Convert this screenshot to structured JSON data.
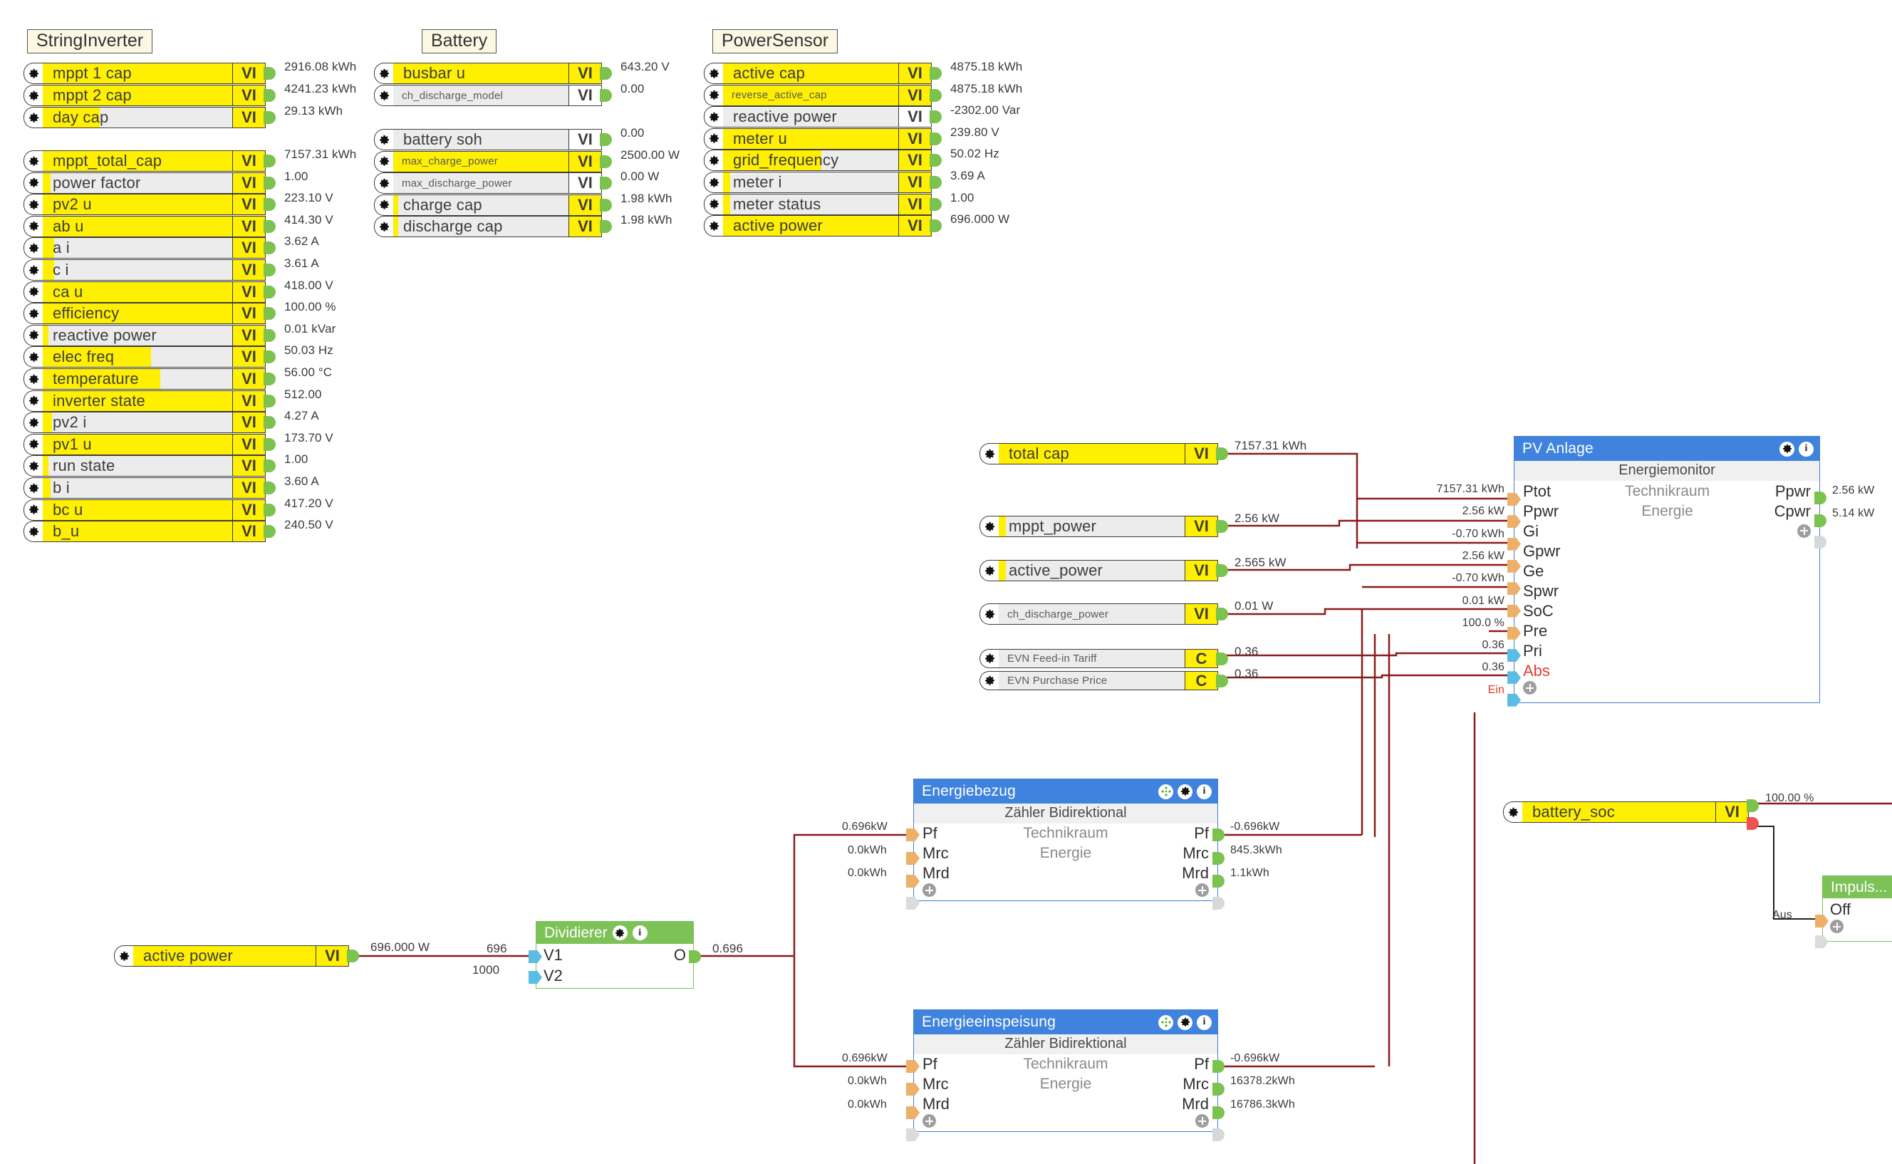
{
  "groups": {
    "string_inverter": {
      "title": "StringInverter"
    },
    "battery": {
      "title": "Battery"
    },
    "power_sensor": {
      "title": "PowerSensor"
    }
  },
  "string_inverter_rows_a": [
    {
      "label": "mppt 1 cap",
      "vi": "VI",
      "value": "2916.08 kWh",
      "fill": 100,
      "vi_yellow": true,
      "small": false
    },
    {
      "label": "mppt 2 cap",
      "vi": "VI",
      "value": "4241.23 kWh",
      "fill": 100,
      "vi_yellow": true,
      "small": false
    },
    {
      "label": "day cap",
      "vi": "VI",
      "value": "29.13 kWh",
      "fill": 30,
      "vi_yellow": true,
      "small": false
    }
  ],
  "string_inverter_rows_b": [
    {
      "label": "mppt_total_cap",
      "vi": "VI",
      "value": "7157.31 kWh",
      "fill": 100,
      "vi_yellow": true,
      "small": false
    },
    {
      "label": "power factor",
      "vi": "VI",
      "value": "1.00",
      "fill": 4,
      "vi_yellow": true,
      "small": false
    },
    {
      "label": "pv2 u",
      "vi": "VI",
      "value": "223.10 V",
      "fill": 100,
      "vi_yellow": true,
      "small": false
    },
    {
      "label": "ab u",
      "vi": "VI",
      "value": "414.30 V",
      "fill": 100,
      "vi_yellow": true,
      "small": false
    },
    {
      "label": "a i",
      "vi": "VI",
      "value": "3.62 A",
      "fill": 6,
      "vi_yellow": true,
      "small": false
    },
    {
      "label": "c i",
      "vi": "VI",
      "value": "3.61 A",
      "fill": 6,
      "vi_yellow": true,
      "small": false
    },
    {
      "label": "ca u",
      "vi": "VI",
      "value": "418.00 V",
      "fill": 100,
      "vi_yellow": true,
      "small": false
    },
    {
      "label": "efficiency",
      "vi": "VI",
      "value": "100.00 %",
      "fill": 100,
      "vi_yellow": true,
      "small": false
    },
    {
      "label": "reactive power",
      "vi": "VI",
      "value": "0.01 kVar",
      "fill": 3,
      "vi_yellow": true,
      "small": false
    },
    {
      "label": "elec freq",
      "vi": "VI",
      "value": "50.03 Hz",
      "fill": 57,
      "vi_yellow": true,
      "small": false
    },
    {
      "label": "temperature",
      "vi": "VI",
      "value": "56.00 °C",
      "fill": 62,
      "vi_yellow": true,
      "small": false
    },
    {
      "label": "inverter state",
      "vi": "VI",
      "value": "512.00",
      "fill": 100,
      "vi_yellow": true,
      "small": false
    },
    {
      "label": "pv2 i",
      "vi": "VI",
      "value": "4.27 A",
      "fill": 5,
      "vi_yellow": true,
      "small": false
    },
    {
      "label": "pv1 u",
      "vi": "VI",
      "value": "173.70 V",
      "fill": 100,
      "vi_yellow": true,
      "small": false
    },
    {
      "label": "run state",
      "vi": "VI",
      "value": "1.00",
      "fill": 3,
      "vi_yellow": true,
      "small": false
    },
    {
      "label": "b i",
      "vi": "VI",
      "value": "3.60 A",
      "fill": 4,
      "vi_yellow": true,
      "small": false
    },
    {
      "label": "bc u",
      "vi": "VI",
      "value": "417.20 V",
      "fill": 100,
      "vi_yellow": true,
      "small": false
    },
    {
      "label": "b_u",
      "vi": "VI",
      "value": "240.50 V",
      "fill": 100,
      "vi_yellow": true,
      "small": false
    }
  ],
  "battery_rows_a": [
    {
      "label": "busbar u",
      "vi": "VI",
      "value": "643.20 V",
      "fill": 100,
      "vi_yellow": true,
      "small": false
    },
    {
      "label": "ch_discharge_model",
      "vi": "VI",
      "value": "0.00",
      "fill": 0,
      "vi_yellow": false,
      "small": true
    }
  ],
  "battery_rows_b": [
    {
      "label": "battery soh",
      "vi": "VI",
      "value": "0.00",
      "fill": 0,
      "vi_yellow": false,
      "small": false
    },
    {
      "label": "max_charge_power",
      "vi": "VI",
      "value": "2500.00 W",
      "fill": 100,
      "vi_yellow": true,
      "small": true
    },
    {
      "label": "max_discharge_power",
      "vi": "VI",
      "value": "0.00 W",
      "fill": 0,
      "vi_yellow": false,
      "small": true
    },
    {
      "label": "charge cap",
      "vi": "VI",
      "value": "1.98 kWh",
      "fill": 3,
      "vi_yellow": true,
      "small": false
    },
    {
      "label": "discharge cap",
      "vi": "VI",
      "value": "1.98 kWh",
      "fill": 3,
      "vi_yellow": true,
      "small": false
    }
  ],
  "power_sensor_rows": [
    {
      "label": "active cap",
      "vi": "VI",
      "value": "4875.18 kWh",
      "fill": 100,
      "vi_yellow": true,
      "small": false
    },
    {
      "label": "reverse_active_cap",
      "vi": "VI",
      "value": "4875.18 kWh",
      "fill": 100,
      "vi_yellow": true,
      "small": true
    },
    {
      "label": "reactive power",
      "vi": "VI",
      "value": "-2302.00 Var",
      "fill": 0,
      "vi_yellow": false,
      "small": false
    },
    {
      "label": "meter u",
      "vi": "VI",
      "value": "239.80 V",
      "fill": 100,
      "vi_yellow": true,
      "small": false
    },
    {
      "label": "grid_frequency",
      "vi": "VI",
      "value": "50.02 Hz",
      "fill": 56,
      "vi_yellow": true,
      "small": false
    },
    {
      "label": "meter i",
      "vi": "VI",
      "value": "3.69 A",
      "fill": 4,
      "vi_yellow": true,
      "small": false
    },
    {
      "label": "meter status",
      "vi": "VI",
      "value": "1.00",
      "fill": 4,
      "vi_yellow": true,
      "small": false
    },
    {
      "label": "active power",
      "vi": "VI",
      "value": "696.000 W",
      "fill": 100,
      "vi_yellow": true,
      "small": false
    }
  ],
  "mid_nodes": [
    {
      "label": "total cap",
      "vi": "VI",
      "value": "7157.31 kWh",
      "fill": 100,
      "vi_yellow": true,
      "small": false
    },
    {
      "label": "mppt_power",
      "vi": "VI",
      "value": "2.56 kW",
      "fill": 4,
      "vi_yellow": true,
      "small": false
    },
    {
      "label": "active_power",
      "vi": "VI",
      "value": "2.565 kW",
      "fill": 4,
      "vi_yellow": true,
      "small": false
    },
    {
      "label": "ch_discharge_power",
      "vi": "VI",
      "value": "0.01 W",
      "fill": 0,
      "vi_yellow": true,
      "small": true
    },
    {
      "label": "EVN Feed-in Tariff",
      "vi": "C",
      "value": "0.36",
      "fill": 0,
      "vi_yellow": true,
      "small": true
    },
    {
      "label": "EVN Purchase Price",
      "vi": "C",
      "value": "0.36",
      "fill": 0,
      "vi_yellow": true,
      "small": true
    }
  ],
  "active_power_node": {
    "label": "active power",
    "vi": "VI",
    "value": "696.000 W",
    "fill": 100
  },
  "battery_soc_node": {
    "label": "battery_soc",
    "vi": "VI",
    "value": "100.00 %",
    "fill": 100
  },
  "pv_anlage": {
    "title": "PV Anlage",
    "subtitle": "Energiemonitor",
    "mid_line_1": "Technikraum",
    "mid_line_2": "Energie",
    "inputs": [
      {
        "pin": "Ptot",
        "value": "7157.31 kWh",
        "type": "orange"
      },
      {
        "pin": "Ppwr",
        "value": "2.56 kW",
        "type": "orange"
      },
      {
        "pin": "Gi",
        "value": "-0.70 kWh",
        "type": "orange"
      },
      {
        "pin": "Gpwr",
        "value": "2.56 kW",
        "type": "orange"
      },
      {
        "pin": "Ge",
        "value": "-0.70 kWh",
        "type": "orange"
      },
      {
        "pin": "Spwr",
        "value": "0.01 kW",
        "type": "orange"
      },
      {
        "pin": "SoC",
        "value": "100.0 %",
        "type": "orange"
      },
      {
        "pin": "Pre",
        "value": "0.36",
        "type": "blue"
      },
      {
        "pin": "Pri",
        "value": "0.36",
        "type": "blue"
      },
      {
        "pin": "Abs",
        "value": "Ein",
        "type": "blue"
      }
    ],
    "outputs": [
      {
        "pin": "Ppwr",
        "value": "2.56 kW"
      },
      {
        "pin": "Cpwr",
        "value": "5.14 kW"
      }
    ]
  },
  "energiebezug": {
    "title": "Energiebezug",
    "subtitle": "Zähler Bidirektional",
    "mid_line_1": "Technikraum",
    "mid_line_2": "Energie",
    "inputs": [
      {
        "pin": "Pf",
        "value": "0.696kW"
      },
      {
        "pin": "Mrc",
        "value": "0.0kWh"
      },
      {
        "pin": "Mrd",
        "value": "0.0kWh"
      }
    ],
    "outputs": [
      {
        "pin": "Pf",
        "value": "-0.696kW"
      },
      {
        "pin": "Mrc",
        "value": "845.3kWh"
      },
      {
        "pin": "Mrd",
        "value": "1.1kWh"
      }
    ]
  },
  "energieeinspeisung": {
    "title": "Energieeinspeisung",
    "subtitle": "Zähler Bidirektional",
    "mid_line_1": "Technikraum",
    "mid_line_2": "Energie",
    "inputs": [
      {
        "pin": "Pf",
        "value": "0.696kW"
      },
      {
        "pin": "Mrc",
        "value": "0.0kWh"
      },
      {
        "pin": "Mrd",
        "value": "0.0kWh"
      }
    ],
    "outputs": [
      {
        "pin": "Pf",
        "value": "-0.696kW"
      },
      {
        "pin": "Mrc",
        "value": "16378.2kWh"
      },
      {
        "pin": "Mrd",
        "value": "16786.3kWh"
      }
    ]
  },
  "dividierer": {
    "title": "Dividierer",
    "inputs": [
      {
        "pin": "V1",
        "value": "696"
      },
      {
        "pin": "V2",
        "value": "1000"
      }
    ],
    "output": {
      "pin": "O",
      "value": "0.696"
    }
  },
  "impuls": {
    "title": "Impuls...",
    "input_label": "Aus",
    "pin": "Off"
  },
  "colors": {
    "highlight": "#ffef00",
    "block_header": "#3f83df",
    "green_header": "#7cc257",
    "wire": "#8b1b1b",
    "output_dot": "#7cc24e",
    "input_dot": "#edb068",
    "input_dot_blue": "#5bbde4",
    "alert_text": "#e8392f"
  }
}
